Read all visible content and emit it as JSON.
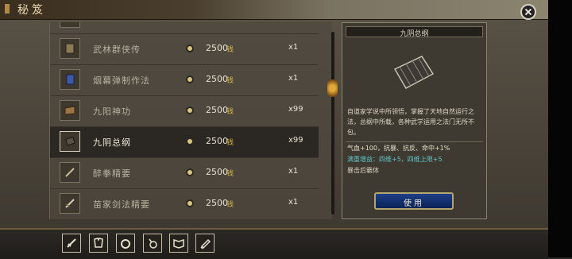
{
  "window": {
    "title": "秘笈"
  },
  "items": [
    {
      "name": "武林群侠传",
      "price": "2500",
      "currency": "钱",
      "qty": "x1",
      "icon": "book-icon"
    },
    {
      "name": "烟幕弹制作法",
      "price": "2500",
      "currency": "钱",
      "qty": "x1",
      "icon": "blue-book-icon"
    },
    {
      "name": "九阳神功",
      "price": "2500",
      "currency": "钱",
      "qty": "x99",
      "icon": "scroll-book-icon"
    },
    {
      "name": "九阴总纲",
      "price": "2500",
      "currency": "钱",
      "qty": "x99",
      "icon": "bamboo-scroll-icon"
    },
    {
      "name": "醉拳精要",
      "price": "2500",
      "currency": "钱",
      "qty": "x1",
      "icon": "dagger-icon"
    },
    {
      "name": "苗家剑法精要",
      "price": "2500",
      "currency": "钱",
      "qty": "x1",
      "icon": "sword-icon"
    }
  ],
  "detail": {
    "title": "九阴总纲",
    "description": "自道家学说中所领悟，掌握了天地自然运行之法，总纲中所载，各种武学运用之法门无所不包。",
    "stats": "气血+100，抗暴、抗反、命中+1%",
    "bonus": "满重增益：四维+5，四维上限+5",
    "extra": "暴击后霸体",
    "use_label": "使用"
  },
  "toolbar": [
    {
      "icon": "sword-icon"
    },
    {
      "icon": "armor-icon"
    },
    {
      "icon": "ring-icon"
    },
    {
      "icon": "potion-icon"
    },
    {
      "icon": "book-icon"
    },
    {
      "icon": "scroll-icon"
    }
  ],
  "colors": {
    "currency": "#d9b94a",
    "bonus": "#5fc6c9",
    "button": "#14306e"
  }
}
